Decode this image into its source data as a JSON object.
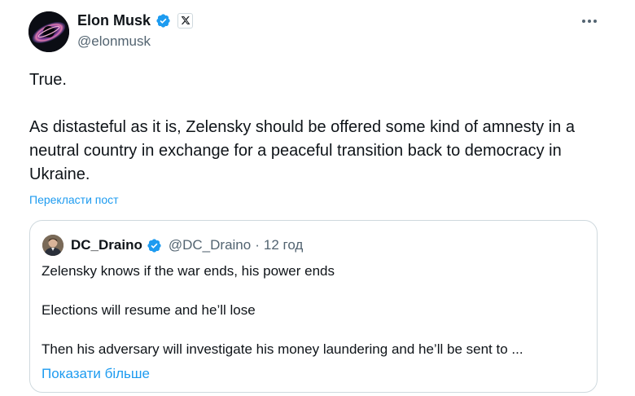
{
  "author": {
    "display_name": "Elon Musk",
    "handle": "@elonmusk",
    "verified": true,
    "affiliation_badge": "x-logo-icon",
    "avatar_icon": "galaxy-avatar"
  },
  "post": {
    "paragraphs": [
      "True.",
      "As distasteful as it is, Zelensky should be offered some kind of amnesty in a neutral country in exchange for a peaceful transition back to democracy in Ukraine."
    ],
    "translate_label": "Перекласти пост"
  },
  "quote": {
    "display_name": "DC_Draino",
    "handle": "@DC_Draino",
    "separator": "·",
    "time": "12 год",
    "verified": true,
    "lines": [
      "Zelensky knows if the war ends, his power ends",
      "Elections will resume and he’ll lose",
      "Then his adversary will investigate his money laundering and he’ll be sent to ..."
    ],
    "show_more_label": "Показати більше"
  },
  "colors": {
    "text": "#0f1419",
    "secondary": "#536471",
    "link": "#1d9bf0",
    "verified": "#1d9bf0",
    "border": "#cfd9de"
  },
  "icons": {
    "more": "more-dots-icon",
    "verified": "verified-badge-icon"
  }
}
